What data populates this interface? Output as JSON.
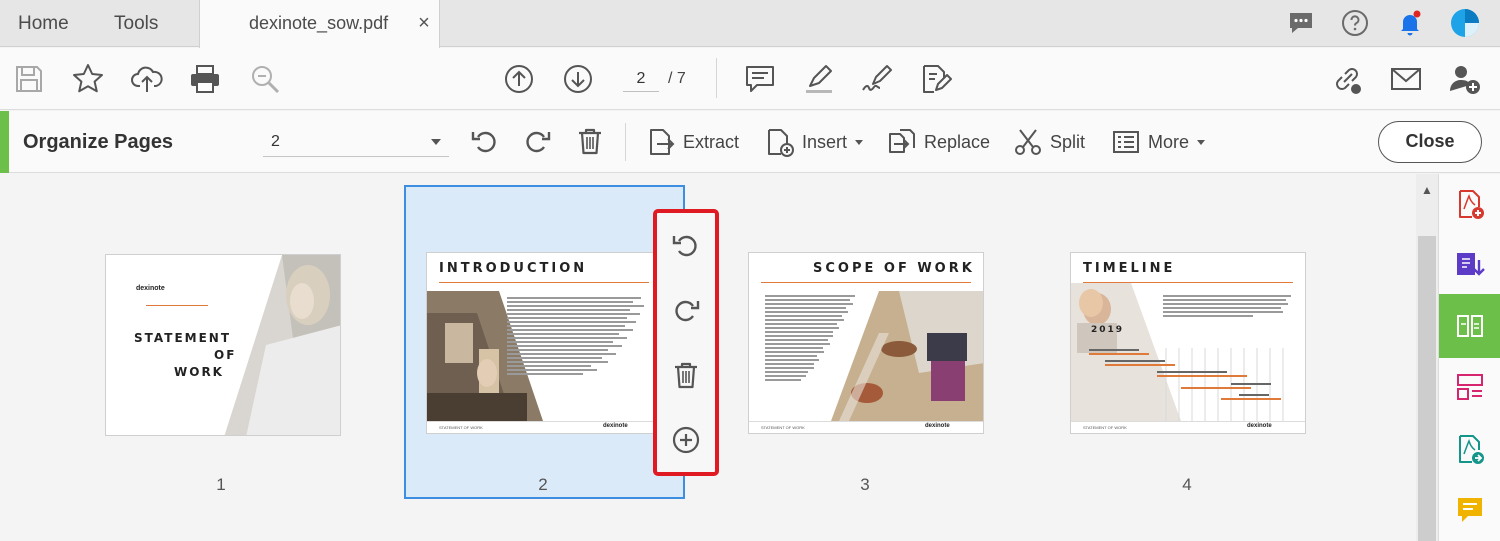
{
  "tabbar": {
    "home": "Home",
    "tools": "Tools",
    "document_tab": "dexinote_sow.pdf",
    "close_glyph": "×",
    "icons": [
      "chat-icon",
      "help-icon",
      "notification-bell-icon",
      "account-avatar-icon"
    ]
  },
  "toolbar": {
    "icons_left": [
      "save-icon",
      "bookmark-star-icon",
      "upload-cloud-icon",
      "print-icon",
      "zoom-icon"
    ],
    "current_page": "2",
    "total_pages": "/ 7",
    "icons_center": [
      "page-up-icon",
      "page-down-icon"
    ],
    "icons_right_group": [
      "comment-icon",
      "highlight-pen-icon",
      "fill-sign-icon",
      "edit-pdf-icon"
    ],
    "icons_far_right": [
      "share-link-icon",
      "email-icon",
      "add-user-icon"
    ]
  },
  "organize": {
    "title": "Organize Pages",
    "page_select_value": "2",
    "extract_label": "Extract",
    "insert_label": "Insert",
    "replace_label": "Replace",
    "split_label": "Split",
    "more_label": "More",
    "close_label": "Close"
  },
  "pages": [
    {
      "number": "1",
      "logo": "dexinote",
      "heading_lines": [
        "STATEMENT",
        "OF",
        "WORK"
      ]
    },
    {
      "number": "2",
      "heading": "INTRODUCTION",
      "footer_left": "STATEMENT OF WORK",
      "logo": "dexinote",
      "selected": true
    },
    {
      "number": "3",
      "heading": "SCOPE OF WORK",
      "footer_left": "STATEMENT OF WORK",
      "logo": "dexinote"
    },
    {
      "number": "4",
      "heading": "TIMELINE",
      "year": "2019",
      "footer_left": "STATEMENT OF WORK",
      "logo": "dexinote"
    }
  ],
  "floating_tools": [
    "rotate-counterclockwise-icon",
    "rotate-clockwise-icon",
    "delete-icon",
    "insert-page-icon"
  ],
  "right_rail": [
    "create-pdf-icon",
    "export-pdf-icon",
    "organize-pages-icon",
    "edit-layout-icon",
    "send-for-review-icon",
    "comment-rail-icon"
  ],
  "colors": {
    "accent_green": "#6cc04a",
    "selection_blue": "#3d8de0",
    "selection_fill": "#dbeaf8",
    "highlight_red": "#e01a22",
    "notification_blue": "#1a73e8",
    "heading_orange_line": "#e07a3a"
  }
}
